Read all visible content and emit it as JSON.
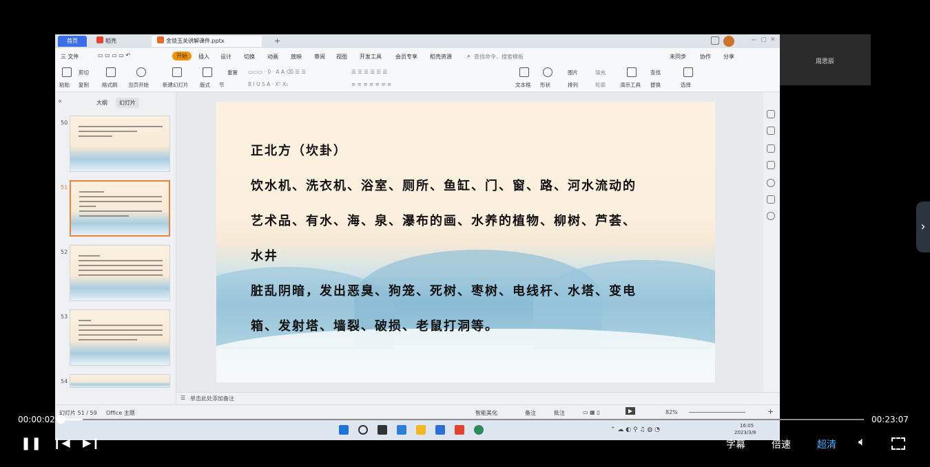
{
  "app": {
    "tabs": {
      "home": "首页",
      "shell": "稻壳",
      "doc": "金锁玉关讲解课件.pptx"
    },
    "menu": [
      "三 文件",
      "开始",
      "插入",
      "设计",
      "切换",
      "动画",
      "放映",
      "审阅",
      "视图",
      "开发工具",
      "会员专享",
      "稻壳资源"
    ],
    "search_placeholder": "查找命令、搜索模板",
    "menu_right": [
      "未同步",
      "协作",
      "分享"
    ],
    "ribbon": {
      "paste": "粘贴",
      "cut": "剪切",
      "copy": "复制",
      "format_painter": "格式刷",
      "from_current": "当页开始",
      "new_slide": "新建幻灯片",
      "layout": "版式",
      "section": "节",
      "reset": "重置",
      "textbox": "文本框",
      "shape": "形状",
      "arrange": "排列",
      "picture": "图片",
      "fill": "填充",
      "outline": "轮廓",
      "present_tools": "演示工具",
      "find": "查找",
      "replace": "替换",
      "select": "选择"
    },
    "pane_tabs": {
      "outline": "大纲",
      "slides": "幻灯片"
    },
    "thumbnails": [
      {
        "num": "50"
      },
      {
        "num": "51"
      },
      {
        "num": "52"
      },
      {
        "num": "53"
      },
      {
        "num": "54"
      }
    ],
    "slide": {
      "title": "正北方（坎卦）",
      "lines": [
        "饮水机、洗衣机、浴室、厕所、鱼缸、门、窗、路、河水流动的",
        "艺术品、有水、海、泉、瀑布的画、水养的植物、柳树、芦荟、",
        "水井",
        "脏乱阴暗，发出恶臭、狗笼、死树、枣树、电线杆、水塔、变电",
        "箱、发射塔、墙裂、破损、老鼠打洞等。"
      ]
    },
    "notes_placeholder": "单击此处添加备注",
    "status": {
      "slide_count": "幻灯片 51 / 59",
      "theme": "Office 主题",
      "smart": "智能美化",
      "notes": "备注",
      "comments": "批注",
      "zoom": "82%"
    },
    "taskbar": {
      "time": "16:05",
      "date": "2023/3/8"
    }
  },
  "side_panel": {
    "name": "周思辰"
  },
  "player": {
    "current_time": "00:00:02",
    "total_time": "00:23:07",
    "progress": 0.0014,
    "buttons": {
      "subtitle": "字幕",
      "speed": "倍速",
      "quality": "超清"
    }
  }
}
